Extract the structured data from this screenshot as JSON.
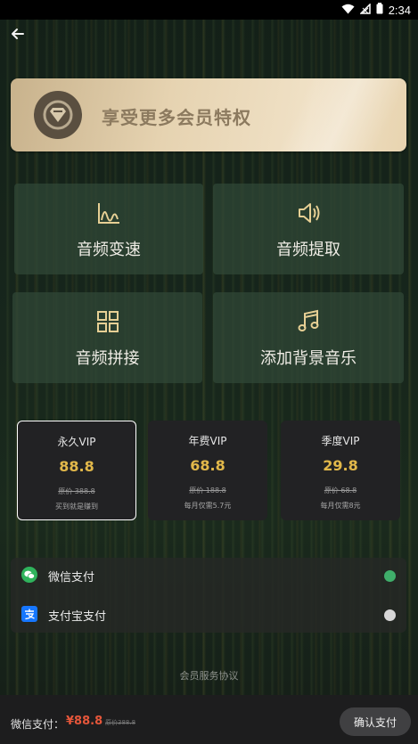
{
  "status_bar": {
    "time": "2:34"
  },
  "banner": {
    "text": "享受更多会员特权"
  },
  "features": [
    {
      "label": "音频变速",
      "icon": "chart-line-icon"
    },
    {
      "label": "音频提取",
      "icon": "speaker-icon"
    },
    {
      "label": "音频拼接",
      "icon": "grid-icon"
    },
    {
      "label": "添加背景音乐",
      "icon": "music-note-icon"
    }
  ],
  "plans": [
    {
      "name": "永久VIP",
      "price": "88.8",
      "original": "原价 388.8",
      "note": "买到就是赚到",
      "selected": true
    },
    {
      "name": "年费VIP",
      "price": "68.8",
      "original": "原价 188.8",
      "note": "每月仅需5.7元",
      "selected": false
    },
    {
      "name": "季度VIP",
      "price": "29.8",
      "original": "原价 68.8",
      "note": "每月仅需8元",
      "selected": false
    }
  ],
  "payment_methods": [
    {
      "label": "微信支付",
      "icon": "wechat-icon",
      "selected": true
    },
    {
      "label": "支付宝支付",
      "icon": "alipay-icon",
      "selected": false
    }
  ],
  "agreement": "会员服务协议",
  "bottom_bar": {
    "label": "微信支付：",
    "price": "¥88.8",
    "original": "原价388.8",
    "confirm_label": "确认支付"
  },
  "colors": {
    "accent_gold": "#e2b84a",
    "price_red": "#e5563a",
    "radio_selected": "#3fae6a",
    "radio_unselected": "#d7d7d7"
  }
}
